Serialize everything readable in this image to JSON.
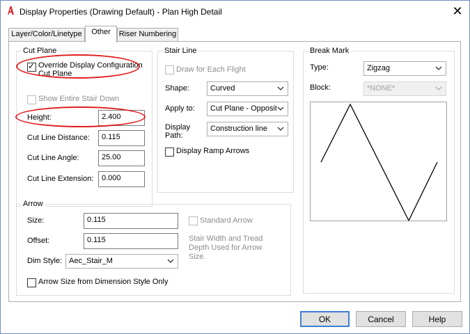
{
  "window": {
    "title": "Display Properties (Drawing Default) - Plan High Detail",
    "app_icon": "autocad-icon",
    "close_icon": "close-icon"
  },
  "tabs": [
    {
      "label": "Layer/Color/Linetype",
      "active": false
    },
    {
      "label": "Other",
      "active": true
    },
    {
      "label": "Riser Numbering",
      "active": false
    }
  ],
  "cut_plane": {
    "title": "Cut Plane",
    "override_label_1": "Override Display Configuration",
    "override_label_2": "Cut Plane",
    "override_checked": true,
    "show_entire_label": "Show Entire Stair Down",
    "show_entire_checked": false,
    "height_label": "Height:",
    "height_value": "2.400",
    "cut_line_distance_label": "Cut Line Distance:",
    "cut_line_distance_value": "0.115",
    "cut_line_angle_label": "Cut Line Angle:",
    "cut_line_angle_value": "25.00",
    "cut_line_extension_label": "Cut Line Extension:",
    "cut_line_extension_value": "0.000"
  },
  "stair_line": {
    "title": "Stair Line",
    "draw_each_flight_label": "Draw for Each Flight",
    "draw_each_flight_checked": false,
    "shape_label": "Shape:",
    "shape_value": "Curved",
    "apply_to_label": "Apply to:",
    "apply_to_value": "Cut Plane - Opposite",
    "display_path_label_1": "Display",
    "display_path_label_2": "Path:",
    "display_path_value": "Construction line",
    "ramp_arrows_label": "Display Ramp Arrows",
    "ramp_arrows_checked": false
  },
  "break_mark": {
    "title": "Break Mark",
    "type_label": "Type:",
    "type_value": "Zigzag",
    "block_label": "Block:",
    "block_value": "*NONE*"
  },
  "arrow": {
    "title": "Arrow",
    "size_label": "Size:",
    "size_value": "0.115",
    "offset_label": "Offset:",
    "offset_value": "0.115",
    "dim_style_label": "Dim Style:",
    "dim_style_value": "Aec_Stair_M",
    "standard_arrow_label": "Standard Arrow",
    "standard_arrow_checked": false,
    "note_line_1": "Stair Width and Tread",
    "note_line_2": "Depth Used for Arrow",
    "note_line_3": "Size.",
    "arrow_from_dim_label": "Arrow Size from Dimension Style Only",
    "arrow_from_dim_checked": false
  },
  "buttons": {
    "ok": "OK",
    "cancel": "Cancel",
    "help": "Help"
  },
  "colors": {
    "highlight_oval": "#e21c1c",
    "default_button_border": "#3c7fd6",
    "app_icon_red": "#d9252b"
  }
}
